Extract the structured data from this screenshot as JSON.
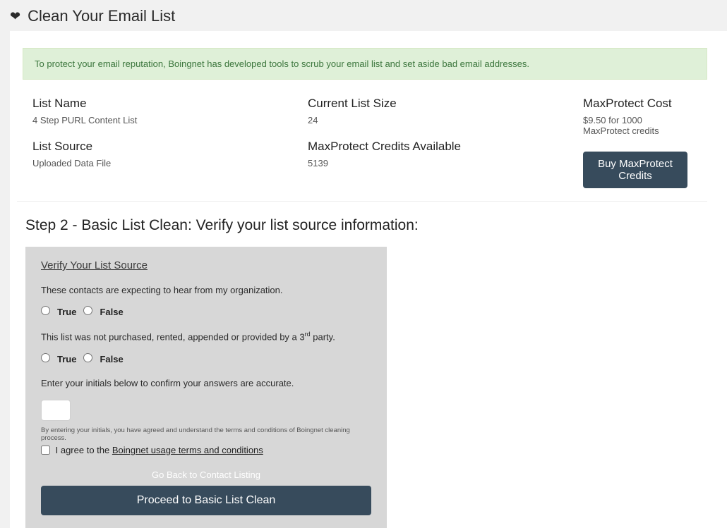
{
  "header": {
    "title": "Clean Your Email List"
  },
  "alert": {
    "message": "To protect your email reputation, Boingnet has developed tools to scrub your email list and set aside bad email addresses."
  },
  "summary": {
    "list_name_label": "List Name",
    "list_name_value": "4 Step PURL Content List",
    "list_source_label": "List Source",
    "list_source_value": "Uploaded Data File",
    "current_size_label": "Current List Size",
    "current_size_value": "24",
    "credits_label": "MaxProtect Credits Available",
    "credits_value": "5139",
    "cost_label": "MaxProtect Cost",
    "cost_value": "$9.50 for 1000 MaxProtect credits",
    "buy_button": "Buy MaxProtect Credits"
  },
  "step": {
    "title": "Step 2 - Basic List Clean: Verify your list source information:"
  },
  "verify": {
    "panel_title": "Verify Your List Source",
    "q1": "These contacts are expecting to hear from my organization.",
    "true_label": "True",
    "false_label": "False",
    "q2_prefix": "This list was not purchased, rented, appended or provided by a 3",
    "q2_sup": "rd",
    "q2_suffix": " party.",
    "initials_prompt": "Enter your initials below to confirm your answers are accurate.",
    "fineprint": "By entering your initials, you have agreed and understand the terms and conditions of Boingnet cleaning process.",
    "agree_prefix": "I agree to the ",
    "agree_link": "Boingnet usage terms and conditions",
    "go_back": "Go Back to Contact Listing",
    "proceed": "Proceed to Basic List Clean"
  }
}
